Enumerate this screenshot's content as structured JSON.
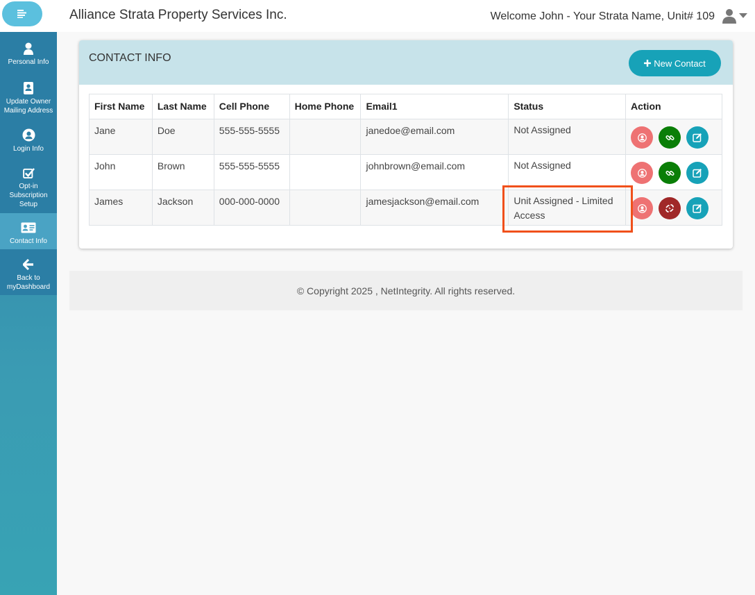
{
  "header": {
    "app_title": "Alliance Strata Property Services Inc.",
    "welcome": "Welcome John - Your Strata Name, Unit# 109",
    "menu_icon": "hamburger-icon",
    "user_icon": "user-icon"
  },
  "sidebar": {
    "items": [
      {
        "label": "Personal Info",
        "icon": "user-icon",
        "active": false
      },
      {
        "label": "Update Owner Mailing Address",
        "icon": "address-book-icon",
        "active": false
      },
      {
        "label": "Login Info",
        "icon": "user-circle-icon",
        "active": false
      },
      {
        "label": "Opt-in Subscription Setup",
        "icon": "checkbox-icon",
        "active": false
      },
      {
        "label": "Contact Info",
        "icon": "id-card-icon",
        "active": true
      },
      {
        "label": "Back to myDashboard",
        "icon": "arrow-left-icon",
        "active": false
      }
    ]
  },
  "panel": {
    "title": "CONTACT INFO",
    "new_contact_label": "New Contact"
  },
  "table": {
    "columns": [
      "First Name",
      "Last Name",
      "Cell Phone",
      "Home Phone",
      "Email1",
      "Status",
      "Action"
    ],
    "rows": [
      {
        "first": "Jane",
        "last": "Doe",
        "cell": "555-555-5555",
        "home": "",
        "email": "janedoe@email.com",
        "status": "Not Assigned",
        "link_state": "link"
      },
      {
        "first": "John",
        "last": "Brown",
        "cell": "555-555-5555",
        "home": "",
        "email": "johnbrown@email.com",
        "status": "Not Assigned",
        "link_state": "link"
      },
      {
        "first": "James",
        "last": "Jackson",
        "cell": "000-000-0000",
        "home": "",
        "email": "jamesjackson@email.com",
        "status": "Unit Assigned - Limited Access",
        "link_state": "unlink"
      }
    ]
  },
  "footer": {
    "copyright": "© Copyright 2025 , NetIntegrity. All rights reserved."
  },
  "colors": {
    "accent": "#17a2b8",
    "sidebar": "#2b7ea5",
    "panel_header": "#c7e3ea",
    "highlight": "#f0501b",
    "user_action": "#ee7273",
    "link_action": "#0a7e07",
    "unlink_action": "#a02828"
  }
}
